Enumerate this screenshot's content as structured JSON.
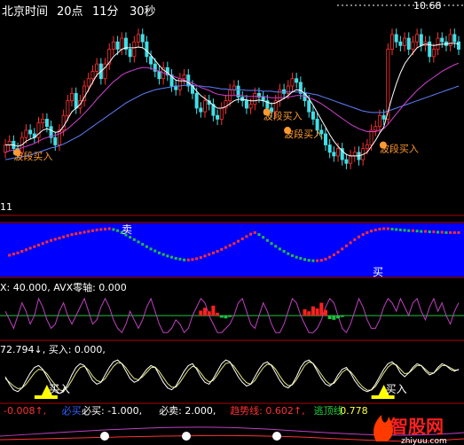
{
  "header": {
    "clock_label": "北京时间",
    "time_hour": "20点",
    "time_minute": "11分",
    "time_second": "30秒",
    "high_price": "10.68"
  },
  "main_panel": {
    "annotations": [
      {
        "text": "波段买入",
        "x": 2,
        "y": 8.95
      },
      {
        "text": "波段买入",
        "x": 62,
        "y": 9.5
      },
      {
        "text": "波段买入",
        "x": 67,
        "y": 9.25
      },
      {
        "text": "波段买入",
        "x": 90,
        "y": 9.05
      }
    ],
    "axis_note": "11"
  },
  "wave_panel": {
    "sell_label": "卖",
    "buy_label": "买"
  },
  "avx_panel": {
    "legend": "X: 40.000, AVX零轴: 0.000"
  },
  "kdj_panel": {
    "legend": "72.794↓, 买入: 0.000,",
    "signals": [
      {
        "text": "买入",
        "x": 10
      },
      {
        "text": "买入",
        "x": 91
      }
    ]
  },
  "bottom_panel": {
    "legend": [
      {
        "text": "-0.008↑,",
        "color": "#ff3030"
      },
      {
        "text": "必买",
        "color": "#3060ff"
      },
      {
        "text": "必买: -1.000,",
        "color": "#ffffff"
      },
      {
        "text": "必卖: 2.000,",
        "color": "#ffffff"
      },
      {
        "text": "趋势线: 0.602↑,",
        "color": "#ff3030"
      },
      {
        "text": "逃顶线",
        "color": "#20d040"
      },
      {
        "text": "0.778",
        "color": "#ffff40"
      }
    ]
  },
  "watermark": {
    "brand": "智股网",
    "url": "zhiyuu.com"
  },
  "colors": {
    "up": "#ff3030",
    "down": "#40e0e8",
    "ma_white": "#ffffff",
    "ma_magenta": "#d040d0",
    "ma_blue": "#6080ff",
    "panel_blue": "#0000ff",
    "label_orange": "#ff9a30",
    "signal_yellow": "#ffff00",
    "avx_line": "#c040c0",
    "zero_line": "#20c040"
  },
  "chart_data": {
    "type": "candlestick",
    "x": [
      0,
      1,
      2,
      3,
      4,
      5,
      6,
      7,
      8,
      9,
      10,
      11,
      12,
      13,
      14,
      15,
      16,
      17,
      18,
      19,
      20,
      21,
      22,
      23,
      24,
      25,
      26,
      27,
      28,
      29,
      30,
      31,
      32,
      33,
      34,
      35,
      36,
      37,
      38,
      39,
      40,
      41,
      42,
      43,
      44,
      45,
      46,
      47,
      48,
      49,
      50,
      51,
      52,
      53,
      54,
      55,
      56,
      57,
      58,
      59,
      60,
      61,
      62,
      63,
      64,
      65,
      66,
      67,
      68,
      69,
      70,
      71,
      72,
      73,
      74,
      75,
      76,
      77,
      78,
      79,
      80,
      81,
      82,
      83,
      84,
      85,
      86,
      87,
      88,
      89,
      90,
      91,
      92,
      93,
      94,
      95,
      96,
      97,
      98,
      99,
      100,
      101,
      102,
      103,
      104,
      105,
      106,
      107,
      108,
      109
    ],
    "close": [
      9.1,
      9.15,
      9.05,
      9.0,
      9.2,
      9.3,
      9.25,
      9.2,
      9.4,
      9.45,
      9.35,
      9.2,
      9.1,
      9.3,
      9.5,
      9.7,
      9.8,
      9.6,
      9.7,
      9.9,
      10.0,
      10.1,
      10.2,
      10.0,
      10.2,
      10.4,
      10.5,
      10.4,
      10.55,
      10.4,
      10.3,
      10.5,
      10.6,
      10.5,
      10.3,
      10.2,
      10.1,
      10.0,
      10.15,
      10.05,
      9.9,
      9.85,
      10.0,
      10.05,
      9.9,
      9.8,
      9.6,
      9.55,
      9.7,
      9.65,
      9.5,
      9.45,
      9.6,
      9.7,
      9.85,
      9.9,
      9.75,
      9.7,
      9.6,
      9.65,
      9.8,
      9.75,
      9.7,
      9.6,
      9.55,
      9.7,
      9.85,
      9.8,
      9.9,
      10.0,
      9.95,
      9.8,
      9.7,
      9.55,
      9.45,
      9.3,
      9.25,
      9.1,
      9.0,
      8.95,
      9.05,
      8.9,
      8.85,
      8.95,
      9.0,
      8.9,
      9.05,
      9.1,
      9.3,
      9.35,
      9.5,
      9.45,
      10.4,
      10.6,
      10.5,
      10.45,
      10.55,
      10.4,
      10.5,
      10.6,
      10.45,
      10.5,
      10.3,
      10.4,
      10.55,
      10.5,
      10.45,
      10.6,
      10.5,
      10.4
    ],
    "open": [
      9.0,
      9.1,
      9.15,
      9.05,
      9.0,
      9.2,
      9.3,
      9.25,
      9.2,
      9.4,
      9.45,
      9.35,
      9.2,
      9.1,
      9.3,
      9.5,
      9.7,
      9.8,
      9.6,
      9.7,
      9.9,
      10.0,
      10.1,
      10.2,
      10.0,
      10.2,
      10.4,
      10.5,
      10.4,
      10.55,
      10.4,
      10.3,
      10.5,
      10.6,
      10.5,
      10.3,
      10.2,
      10.1,
      10.0,
      10.15,
      10.05,
      9.9,
      9.85,
      10.0,
      10.05,
      9.9,
      9.8,
      9.6,
      9.55,
      9.7,
      9.65,
      9.5,
      9.45,
      9.6,
      9.7,
      9.85,
      9.9,
      9.75,
      9.7,
      9.6,
      9.65,
      9.8,
      9.75,
      9.7,
      9.6,
      9.55,
      9.7,
      9.85,
      9.8,
      9.9,
      10.0,
      9.95,
      9.8,
      9.7,
      9.55,
      9.45,
      9.3,
      9.25,
      9.1,
      9.0,
      8.95,
      9.05,
      8.9,
      8.85,
      8.95,
      9.0,
      8.9,
      9.05,
      9.1,
      9.3,
      9.35,
      9.5,
      9.45,
      10.4,
      10.6,
      10.5,
      10.45,
      10.55,
      10.4,
      10.5,
      10.6,
      10.45,
      10.5,
      10.3,
      10.4,
      10.55,
      10.5,
      10.45,
      10.6,
      10.5
    ],
    "ma_white": [
      9.1,
      9.1,
      9.1,
      9.08,
      9.1,
      9.15,
      9.18,
      9.2,
      9.25,
      9.3,
      9.32,
      9.3,
      9.27,
      9.28,
      9.35,
      9.45,
      9.55,
      9.6,
      9.65,
      9.75,
      9.85,
      9.95,
      10.05,
      10.1,
      10.15,
      10.22,
      10.3,
      10.35,
      10.4,
      10.42,
      10.42,
      10.42,
      10.43,
      10.42,
      10.38,
      10.32,
      10.25,
      10.18,
      10.12,
      10.08,
      10.03,
      9.98,
      9.97,
      9.97,
      9.95,
      9.9,
      9.83,
      9.77,
      9.73,
      9.69,
      9.64,
      9.6,
      9.6,
      9.62,
      9.66,
      9.7,
      9.72,
      9.72,
      9.71,
      9.7,
      9.7,
      9.71,
      9.7,
      9.68,
      9.66,
      9.67,
      9.7,
      9.73,
      9.77,
      9.82,
      9.85,
      9.84,
      9.8,
      9.73,
      9.64,
      9.54,
      9.44,
      9.34,
      9.24,
      9.15,
      9.08,
      9.02,
      8.97,
      8.95,
      8.95,
      8.95,
      8.97,
      9.0,
      9.08,
      9.16,
      9.26,
      9.34,
      9.55,
      9.75,
      9.93,
      10.08,
      10.2,
      10.28,
      10.35,
      10.42,
      10.45,
      10.47,
      10.46,
      10.45,
      10.46,
      10.47,
      10.47,
      10.48,
      10.48,
      10.47
    ],
    "ma_magenta": [
      9.0,
      9.02,
      9.03,
      9.04,
      9.06,
      9.08,
      9.1,
      9.12,
      9.15,
      9.18,
      9.2,
      9.22,
      9.23,
      9.25,
      9.28,
      9.32,
      9.37,
      9.42,
      9.47,
      9.53,
      9.59,
      9.65,
      9.72,
      9.78,
      9.84,
      9.9,
      9.96,
      10.0,
      10.05,
      10.08,
      10.1,
      10.12,
      10.14,
      10.15,
      10.15,
      10.14,
      10.12,
      10.1,
      10.08,
      10.06,
      10.04,
      10.02,
      10.0,
      9.98,
      9.96,
      9.94,
      9.91,
      9.88,
      9.86,
      9.84,
      9.81,
      9.79,
      9.78,
      9.77,
      9.77,
      9.77,
      9.77,
      9.77,
      9.76,
      9.76,
      9.76,
      9.76,
      9.76,
      9.75,
      9.74,
      9.74,
      9.74,
      9.74,
      9.75,
      9.76,
      9.77,
      9.77,
      9.76,
      9.74,
      9.72,
      9.69,
      9.66,
      9.62,
      9.58,
      9.54,
      9.5,
      9.46,
      9.42,
      9.38,
      9.35,
      9.32,
      9.3,
      9.28,
      9.28,
      9.28,
      9.3,
      9.32,
      9.38,
      9.45,
      9.52,
      9.59,
      9.66,
      9.72,
      9.78,
      9.84,
      9.89,
      9.94,
      9.98,
      10.02,
      10.06,
      10.1,
      10.13,
      10.16,
      10.19,
      10.21
    ],
    "ma_blue": [
      8.9,
      8.91,
      8.92,
      8.93,
      8.94,
      8.95,
      8.96,
      8.98,
      9.0,
      9.02,
      9.04,
      9.06,
      9.07,
      9.09,
      9.11,
      9.14,
      9.17,
      9.2,
      9.23,
      9.27,
      9.31,
      9.35,
      9.39,
      9.43,
      9.47,
      9.51,
      9.55,
      9.59,
      9.63,
      9.67,
      9.7,
      9.73,
      9.76,
      9.79,
      9.81,
      9.83,
      9.85,
      9.86,
      9.87,
      9.88,
      9.89,
      9.9,
      9.9,
      9.91,
      9.91,
      9.91,
      9.9,
      9.9,
      9.89,
      9.89,
      9.88,
      9.87,
      9.86,
      9.86,
      9.85,
      9.85,
      9.85,
      9.85,
      9.84,
      9.84,
      9.84,
      9.84,
      9.83,
      9.83,
      9.83,
      9.82,
      9.82,
      9.82,
      9.82,
      9.82,
      9.82,
      9.82,
      9.81,
      9.8,
      9.79,
      9.78,
      9.76,
      9.74,
      9.72,
      9.7,
      9.68,
      9.66,
      9.64,
      9.62,
      9.6,
      9.58,
      9.56,
      9.55,
      9.54,
      9.54,
      9.54,
      9.54,
      9.56,
      9.58,
      9.6,
      9.62,
      9.64,
      9.66,
      9.68,
      9.7,
      9.72,
      9.74,
      9.76,
      9.78,
      9.8,
      9.82,
      9.84,
      9.86,
      9.88,
      9.9
    ],
    "ylim": [
      8.6,
      10.9
    ],
    "wave": [
      0.3,
      0.32,
      0.35,
      0.38,
      0.42,
      0.46,
      0.5,
      0.54,
      0.58,
      0.62,
      0.66,
      0.7,
      0.73,
      0.76,
      0.79,
      0.82,
      0.85,
      0.87,
      0.89,
      0.91,
      0.93,
      0.95,
      0.97,
      0.98,
      0.99,
      1.0,
      0.98,
      0.95,
      0.9,
      0.84,
      0.78,
      0.72,
      0.66,
      0.6,
      0.54,
      0.48,
      0.43,
      0.38,
      0.34,
      0.3,
      0.27,
      0.24,
      0.22,
      0.2,
      0.2,
      0.21,
      0.23,
      0.26,
      0.3,
      0.34,
      0.38,
      0.42,
      0.47,
      0.52,
      0.57,
      0.62,
      0.68,
      0.74,
      0.8,
      0.86,
      0.9,
      0.85,
      0.78,
      0.7,
      0.62,
      0.55,
      0.48,
      0.42,
      0.36,
      0.31,
      0.27,
      0.24,
      0.21,
      0.19,
      0.18,
      0.18,
      0.19,
      0.22,
      0.27,
      0.33,
      0.4,
      0.48,
      0.56,
      0.64,
      0.72,
      0.79,
      0.85,
      0.9,
      0.94,
      0.97,
      0.99,
      1.0,
      1.0,
      0.99,
      0.98,
      0.97,
      0.96,
      0.95,
      0.95,
      0.94,
      0.93,
      0.93,
      0.92,
      0.92,
      0.91,
      0.91,
      0.9,
      0.9,
      0.9,
      0.9
    ],
    "avx_line": [
      0.6,
      0.4,
      0.2,
      0.5,
      0.8,
      0.6,
      0.3,
      0.5,
      0.9,
      0.7,
      0.4,
      0.2,
      0.3,
      0.6,
      0.8,
      0.5,
      0.3,
      0.5,
      0.7,
      0.9,
      0.6,
      0.3,
      0.4,
      0.7,
      0.9,
      0.7,
      0.4,
      0.2,
      0.1,
      0.3,
      0.6,
      0.4,
      0.2,
      0.4,
      0.7,
      0.9,
      0.6,
      0.3,
      0.1,
      0.1,
      0.2,
      0.4,
      0.3,
      0.1,
      0.2,
      0.5,
      0.7,
      0.9,
      0.8,
      0.5,
      0.3,
      0.1,
      0.1,
      0.2,
      0.3,
      0.5,
      0.8,
      0.9,
      0.6,
      0.3,
      0.2,
      0.5,
      0.8,
      0.6,
      0.3,
      0.1,
      0.1,
      0.3,
      0.6,
      0.9,
      0.8,
      0.5,
      0.3,
      0.1,
      0.1,
      0.2,
      0.4,
      0.7,
      0.9,
      0.8,
      0.5,
      0.2,
      0.1,
      0.3,
      0.6,
      0.9,
      0.7,
      0.4,
      0.2,
      0.2,
      0.4,
      0.7,
      0.9,
      0.8,
      0.6,
      0.9,
      0.7,
      0.5,
      0.8,
      0.9,
      0.6,
      0.4,
      0.7,
      0.9,
      0.6,
      0.8,
      0.5,
      0.3,
      0.6,
      0.8
    ],
    "avx_bars": [
      {
        "x": 47,
        "v": 0.35
      },
      {
        "x": 48,
        "v": 0.55
      },
      {
        "x": 49,
        "v": 0.3
      },
      {
        "x": 50,
        "v": 0.7
      },
      {
        "x": 51,
        "v": 0.2
      },
      {
        "x": 52,
        "v": -0.15
      },
      {
        "x": 53,
        "v": -0.2
      },
      {
        "x": 54,
        "v": -0.1
      },
      {
        "x": 72,
        "v": 0.45
      },
      {
        "x": 73,
        "v": 0.3
      },
      {
        "x": 74,
        "v": 0.65
      },
      {
        "x": 75,
        "v": 0.5
      },
      {
        "x": 76,
        "v": 0.9
      },
      {
        "x": 77,
        "v": 0.4
      },
      {
        "x": 78,
        "v": -0.25
      },
      {
        "x": 79,
        "v": -0.3
      },
      {
        "x": 80,
        "v": -0.2
      },
      {
        "x": 81,
        "v": -0.1
      }
    ],
    "kdj_white": [
      0.5,
      0.3,
      0.15,
      0.1,
      0.2,
      0.4,
      0.6,
      0.75,
      0.8,
      0.7,
      0.5,
      0.3,
      0.15,
      0.05,
      0.1,
      0.3,
      0.55,
      0.75,
      0.85,
      0.8,
      0.6,
      0.4,
      0.3,
      0.35,
      0.55,
      0.75,
      0.9,
      0.95,
      0.85,
      0.65,
      0.45,
      0.35,
      0.4,
      0.55,
      0.7,
      0.8,
      0.75,
      0.55,
      0.35,
      0.2,
      0.15,
      0.25,
      0.45,
      0.65,
      0.8,
      0.85,
      0.7,
      0.5,
      0.35,
      0.3,
      0.45,
      0.65,
      0.85,
      0.95,
      0.9,
      0.7,
      0.5,
      0.35,
      0.25,
      0.3,
      0.5,
      0.7,
      0.85,
      0.9,
      0.8,
      0.6,
      0.4,
      0.25,
      0.2,
      0.3,
      0.5,
      0.75,
      0.9,
      0.95,
      0.85,
      0.65,
      0.45,
      0.3,
      0.25,
      0.35,
      0.55,
      0.7,
      0.75,
      0.6,
      0.4,
      0.25,
      0.15,
      0.1,
      0.15,
      0.3,
      0.5,
      0.7,
      0.85,
      0.9,
      0.8,
      0.6,
      0.5,
      0.6,
      0.75,
      0.85,
      0.8,
      0.65,
      0.55,
      0.6,
      0.75,
      0.85,
      0.8,
      0.7,
      0.65,
      0.7
    ],
    "kdj_yellow": [
      0.45,
      0.35,
      0.25,
      0.18,
      0.2,
      0.3,
      0.45,
      0.6,
      0.7,
      0.68,
      0.58,
      0.42,
      0.28,
      0.15,
      0.12,
      0.22,
      0.4,
      0.6,
      0.75,
      0.78,
      0.68,
      0.52,
      0.4,
      0.36,
      0.45,
      0.62,
      0.78,
      0.88,
      0.86,
      0.74,
      0.58,
      0.45,
      0.42,
      0.5,
      0.62,
      0.74,
      0.76,
      0.64,
      0.48,
      0.32,
      0.22,
      0.22,
      0.35,
      0.52,
      0.68,
      0.78,
      0.74,
      0.6,
      0.45,
      0.36,
      0.4,
      0.55,
      0.72,
      0.86,
      0.88,
      0.78,
      0.62,
      0.46,
      0.34,
      0.3,
      0.4,
      0.58,
      0.74,
      0.84,
      0.82,
      0.7,
      0.52,
      0.36,
      0.26,
      0.28,
      0.42,
      0.62,
      0.8,
      0.9,
      0.86,
      0.72,
      0.56,
      0.4,
      0.3,
      0.32,
      0.46,
      0.62,
      0.7,
      0.64,
      0.5,
      0.34,
      0.22,
      0.14,
      0.14,
      0.24,
      0.42,
      0.6,
      0.76,
      0.85,
      0.82,
      0.7,
      0.58,
      0.6,
      0.7,
      0.8,
      0.8,
      0.7,
      0.6,
      0.6,
      0.7,
      0.8,
      0.8,
      0.74,
      0.68,
      0.68
    ]
  }
}
